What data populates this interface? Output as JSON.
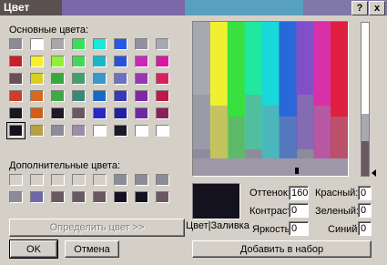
{
  "window": {
    "title": "Цвет",
    "help_label": "?",
    "close_label": "x"
  },
  "basic": {
    "label": "Основные цвета:",
    "rows": [
      [
        "#8c8c94",
        "#ffffff",
        "#a8a8a8",
        "#38e05a",
        "#18e8d8",
        "#2858e8",
        "#9090a0",
        "#a8a8b0"
      ],
      [
        "#c82028",
        "#f8f028",
        "#90f038",
        "#40d858",
        "#18b8c8",
        "#2850d8",
        "#c828b8",
        "#d818a0"
      ],
      [
        "#6a5058",
        "#d8d020",
        "#38a840",
        "#40a070",
        "#3898c8",
        "#7070c0",
        "#9838b0",
        "#d82060"
      ],
      [
        "#c84028",
        "#d86820",
        "#40a848",
        "#3a8878",
        "#1868c8",
        "#3838b8",
        "#8028a8",
        "#c01848"
      ],
      [
        "#181820",
        "#d06018",
        "#1c1a28",
        "#6a5860",
        "#2828c8",
        "#2020a0",
        "#7028a0",
        "#8a2058"
      ],
      [
        "#14121e",
        "#b8a040",
        "#8c8c98",
        "#9c8ca8",
        "#ffffff",
        "#1c1a28",
        "#ffffff",
        "#ffffff"
      ]
    ]
  },
  "custom": {
    "label": "Дополнительные цвета:",
    "rows": [
      [
        "#d4d0c8",
        "#d4d0c8",
        "#d4d0c8",
        "#d4d0c8",
        "#d4d0c8",
        "#8c8c98",
        "#8c8c98",
        "#8c8c98"
      ],
      [
        "#8c8c98",
        "#7068a8",
        "#6a5860",
        "#6a5860",
        "#6a5860",
        "#14121e",
        "#14121e",
        "#6a5860"
      ]
    ]
  },
  "buttons": {
    "define": "Определить цвет >>",
    "ok": "OK",
    "cancel": "Отмена",
    "add": "Добавить в набор"
  },
  "preview": {
    "label": "Цвет|Заливка",
    "color": "#14121e"
  },
  "fields": {
    "hue_label": "Оттенок:",
    "hue": "160",
    "sat_label": "Контраст:",
    "sat": "0",
    "lum_label": "Яркость:",
    "lum": "0",
    "red_label": "Красный:",
    "red": "0",
    "green_label": "Зеленый:",
    "green": "0",
    "blue_label": "Синий:",
    "blue": "0"
  },
  "spectrum_colors": [
    "#a8a8b0",
    "#f0f030",
    "#38e040",
    "#20e8a0",
    "#18d8d8",
    "#2868d8",
    "#8050c8",
    "#d830a8",
    "#e02040"
  ]
}
